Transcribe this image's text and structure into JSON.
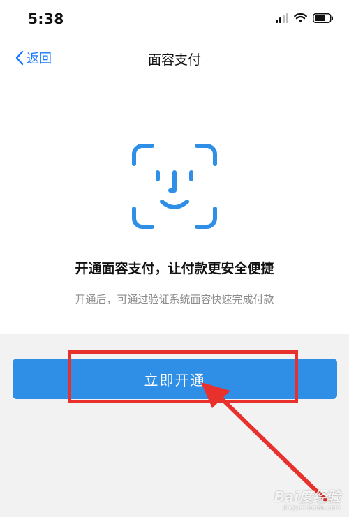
{
  "status_bar": {
    "time": "5:38"
  },
  "nav": {
    "back_label": "返回",
    "title": "面容支付"
  },
  "main": {
    "headline": "开通面容支付，让付款更安全便捷",
    "subtext": "开通后，可通过验证系统面容快速完成付款"
  },
  "action": {
    "open_label": "立即开通"
  },
  "watermark": {
    "logo_text": "Bai度经验",
    "url": "jingyan.baidu.com"
  },
  "colors": {
    "accent": "#1677ff",
    "button": "#2f8fe6",
    "annotation": "#e8312d"
  },
  "icons": {
    "back": "chevron-left-icon",
    "face": "face-id-icon",
    "signal": "signal-icon",
    "wifi": "wifi-icon",
    "battery": "battery-icon"
  }
}
